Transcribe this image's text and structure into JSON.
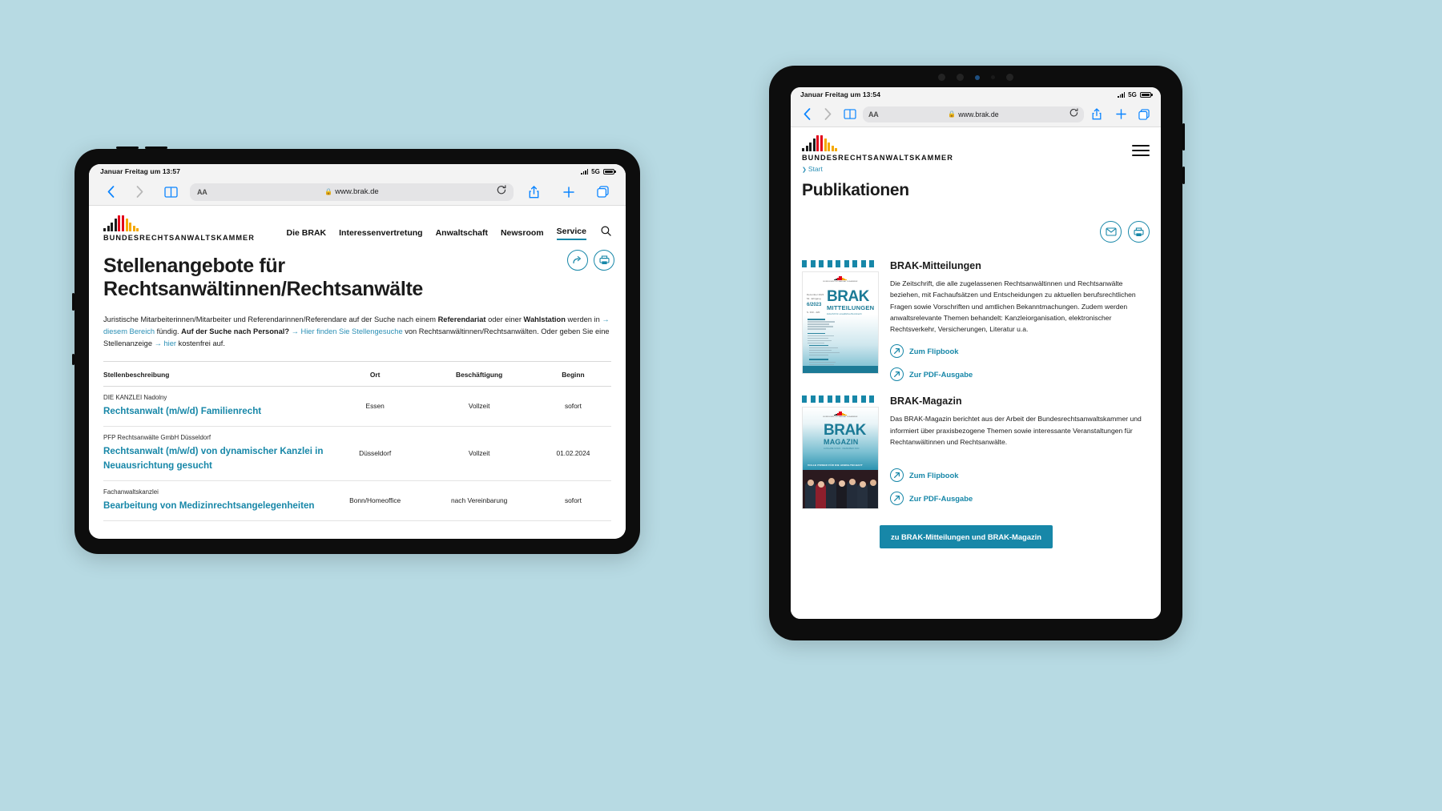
{
  "background_color": "#b7dae3",
  "accent_color": "#1787a8",
  "link_color": "#2a8fb5",
  "left_tablet": {
    "status_bar": {
      "datetime": "Januar Freitag um 13:57",
      "network": "5G"
    },
    "browser": {
      "back_icon": "chevron-left-icon",
      "forward_icon": "chevron-right-icon",
      "bookmarks_icon": "book-icon",
      "text_size_label": "AA",
      "lock_icon": "lock-icon",
      "url": "www.brak.de",
      "reload_icon": "reload-icon",
      "share_icon": "share-icon",
      "new_tab_icon": "plus-icon",
      "tabs_icon": "tabs-icon"
    },
    "site": {
      "logo_wordmark": "BUNDESRECHTSANWALTSKAMMER",
      "nav": [
        {
          "label": "Die BRAK",
          "active": false
        },
        {
          "label": "Interessenvertretung",
          "active": false
        },
        {
          "label": "Anwaltschaft",
          "active": false
        },
        {
          "label": "Newsroom",
          "active": false
        },
        {
          "label": "Service",
          "active": true
        }
      ],
      "search_icon": "search-icon",
      "float_actions": [
        {
          "icon": "share-arrow-icon",
          "name": "share-page-button"
        },
        {
          "icon": "print-icon",
          "name": "print-page-button"
        }
      ],
      "page_title_line1": "Stellenangebote für",
      "page_title_line2": "Rechtsanwältinnen/Rechtsanwälte",
      "intro": {
        "p1": "Juristische Mitarbeiterinnen/Mitarbeiter und Referendarinnen/Referendare auf der Suche nach einem ",
        "bold1": "Referendariat",
        "p2": " oder einer ",
        "bold2": "Wahlstation",
        "p3": " werden in ",
        "link1": "→ diesem Bereich",
        "p4": " fündig. ",
        "bold3": "Auf der Suche nach Personal?",
        "p5": " ",
        "link2": "→ Hier finden Sie Stellengesuche",
        "p6": " von Rechtsanwältinnen/Rechtsanwälten. Oder geben Sie eine Stellenanzeige ",
        "link3": "→ hier",
        "p7": " kostenfrei auf."
      },
      "table": {
        "headers": [
          "Stellenbeschreibung",
          "Ort",
          "Beschäftigung",
          "Beginn"
        ],
        "rows": [
          {
            "firm": "DIE KANZLEI Nadolny",
            "title": "Rechtsanwalt (m/w/d) Familienrecht",
            "ort": "Essen",
            "beschaeftigung": "Vollzeit",
            "beginn": "sofort"
          },
          {
            "firm": "PFP Rechtsanwälte GmbH Düsseldorf",
            "title": "Rechtsanwalt (m/w/d) von dynamischer Kanzlei in Neuausrichtung gesucht",
            "ort": "Düsseldorf",
            "beschaeftigung": "Vollzeit",
            "beginn": "01.02.2024"
          },
          {
            "firm": "Fachanwaltskanzlei",
            "title": "Bearbeitung von Medizinrechtsangelegenheiten",
            "ort": "Bonn/Homeoffice",
            "beschaeftigung": "nach Vereinbarung",
            "beginn": "sofort"
          }
        ]
      }
    }
  },
  "right_tablet": {
    "status_bar": {
      "datetime": "Januar Freitag um 13:54",
      "network": "5G"
    },
    "browser": {
      "back_icon": "chevron-left-icon",
      "forward_icon": "chevron-right-icon",
      "bookmarks_icon": "book-icon",
      "text_size_label": "AA",
      "lock_icon": "lock-icon",
      "url": "www.brak.de",
      "reload_icon": "reload-icon",
      "share_icon": "share-icon",
      "new_tab_icon": "plus-icon",
      "tabs_icon": "tabs-icon"
    },
    "site": {
      "logo_wordmark": "BUNDESRECHTSANWALTSKAMMER",
      "menu_icon": "hamburger-menu-icon",
      "breadcrumb": "Start",
      "page_title": "Publikationen",
      "actions": [
        {
          "icon": "email-icon",
          "name": "share-email-button"
        },
        {
          "icon": "print-icon",
          "name": "print-page-button"
        }
      ],
      "publications": [
        {
          "heading": "BRAK-Mitteilungen",
          "cover": {
            "brand": "BUNDESRECHTSANWALTSKAMMER",
            "title": "BRAK",
            "subtitle": "MITTEILUNGEN",
            "tagline": "Zeitschrift für anwaltliches Berufsrecht",
            "issue": "6/2023",
            "meta_top": "Dezember 2023\n54. Jahrgang",
            "meta_bottom": "S. 333 - 420"
          },
          "description": "Die Zeitschrift, die alle zugelassenen Rechtsanwältinnen und Rechtsanwälte beziehen, mit Fachaufsätzen und Entscheidungen zu aktuellen berufsrechtlichen Fragen sowie Vorschriften und amtlichen Bekanntmachungen. Zudem werden anwaltsrelevante Themen behandelt: Kanzleiorganisation, elektronischer Rechtsverkehr, Versicherungen, Literatur u.a.",
          "links": [
            {
              "label": "Zum Flipbook",
              "icon": "external-link-icon"
            },
            {
              "label": "Zur PDF-Ausgabe",
              "icon": "external-link-icon"
            }
          ]
        },
        {
          "heading": "BRAK-Magazin",
          "cover": {
            "brand": "BUNDESRECHTSANWALTSKAMMER",
            "title": "BRAK",
            "subtitle": "MAGAZIN",
            "tagline": "AUSGABE 6/2023 · DEZEMBER 2023",
            "banner": "VOLLE POWER FÜR DIE ANWALTSCHAFT",
            "banner_sub": "BUNDESRECHTSANWALTSKAMMER"
          },
          "description": "Das BRAK-Magazin berichtet aus der Arbeit der Bundesrechtsanwaltskammer und informiert über praxisbezogene Themen sowie interessante Veranstaltungen für Rechtanwältinnen und Rechtsanwälte.",
          "links": [
            {
              "label": "Zum Flipbook",
              "icon": "external-link-icon"
            },
            {
              "label": "Zur PDF-Ausgabe",
              "icon": "external-link-icon"
            }
          ]
        }
      ],
      "cta_label": "zu BRAK-Mitteilungen und BRAK-Magazin"
    }
  }
}
